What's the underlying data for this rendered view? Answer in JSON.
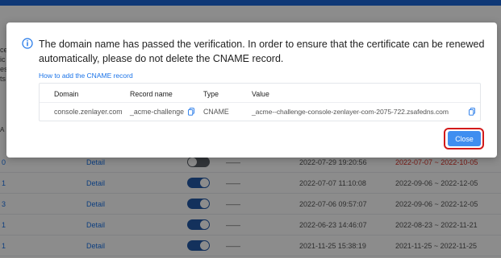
{
  "dialog": {
    "message": "The domain name has passed the verification. In order to ensure that the certificate can be renewed automatically, please do not delete the CNAME record.",
    "help_link": "How to add the CNAME record",
    "table": {
      "headers": [
        "Domain",
        "Record name",
        "Type",
        "Value"
      ],
      "row": {
        "domain": "console.zenlayer.com",
        "record_name": "_acme-challenge",
        "type": "CNAME",
        "value": "_acme--challenge-console-zenlayer-com-2075-722.zsafedns.com"
      }
    },
    "close_label": "Close"
  },
  "background": {
    "left_fragments": [
      "ce",
      "ic",
      "es",
      "ts"
    ],
    "rows": [
      {
        "index": "0",
        "detail": "Detail",
        "toggle_on": false,
        "dash": "——",
        "created": "2022-07-29 19:20:56",
        "validity": "2022-07-07 ~ 2022-10-05",
        "expired": true
      },
      {
        "index": "1",
        "detail": "Detail",
        "toggle_on": true,
        "dash": "——",
        "created": "2022-07-07 11:10:08",
        "validity": "2022-09-06 ~ 2022-12-05",
        "expired": false
      },
      {
        "index": "3",
        "detail": "Detail",
        "toggle_on": true,
        "dash": "——",
        "created": "2022-07-06 09:57:07",
        "validity": "2022-09-06 ~ 2022-12-05",
        "expired": false
      },
      {
        "index": "1",
        "detail": "Detail",
        "toggle_on": true,
        "dash": "——",
        "created": "2022-06-23 14:46:07",
        "validity": "2022-08-23 ~ 2022-11-21",
        "expired": false
      },
      {
        "index": "1",
        "detail": "Detail",
        "toggle_on": true,
        "dash": "——",
        "created": "2021-11-25 15:38:19",
        "validity": "2021-11-25 ~ 2022-11-25",
        "expired": false
      }
    ]
  },
  "colors": {
    "accent": "#1a73e8",
    "button": "#3f8ef0",
    "highlight_ring": "#d21a1a",
    "expired": "#d93025"
  }
}
